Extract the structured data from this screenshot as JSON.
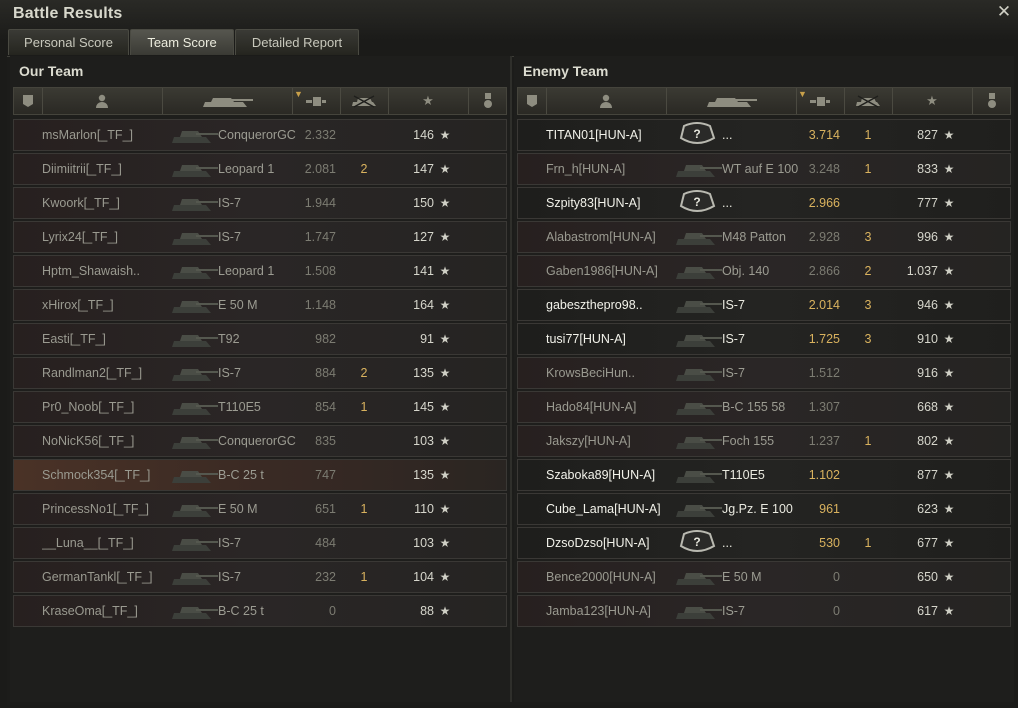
{
  "window": {
    "title": "Battle Results"
  },
  "tabs": [
    {
      "label": "Personal Score",
      "active": false
    },
    {
      "label": "Team Score",
      "active": true
    },
    {
      "label": "Detailed Report",
      "active": false
    }
  ],
  "our_team": {
    "title": "Our Team",
    "rows": [
      {
        "player": "msMarlon[_TF_]",
        "tank": "ConquerorGC",
        "damage": "2.332",
        "kills": "",
        "xp": "146",
        "alive": false,
        "highlight": false
      },
      {
        "player": "Diimiitrii[_TF_]",
        "tank": "Leopard 1",
        "damage": "2.081",
        "kills": "2",
        "xp": "147",
        "alive": false,
        "highlight": false
      },
      {
        "player": "Kwoork[_TF_]",
        "tank": "IS-7",
        "damage": "1.944",
        "kills": "",
        "xp": "150",
        "alive": false,
        "highlight": false
      },
      {
        "player": "Lyrix24[_TF_]",
        "tank": "IS-7",
        "damage": "1.747",
        "kills": "",
        "xp": "127",
        "alive": false,
        "highlight": false
      },
      {
        "player": "Hptm_Shawaish..",
        "tank": "Leopard 1",
        "damage": "1.508",
        "kills": "",
        "xp": "141",
        "alive": false,
        "highlight": false
      },
      {
        "player": "xHirox[_TF_]",
        "tank": "E 50 M",
        "damage": "1.148",
        "kills": "",
        "xp": "164",
        "alive": false,
        "highlight": false
      },
      {
        "player": "Easti[_TF_]",
        "tank": "T92",
        "damage": "982",
        "kills": "",
        "xp": "91",
        "alive": false,
        "highlight": false
      },
      {
        "player": "Randlman2[_TF_]",
        "tank": "IS-7",
        "damage": "884",
        "kills": "2",
        "xp": "135",
        "alive": false,
        "highlight": false
      },
      {
        "player": "Pr0_Noob[_TF_]",
        "tank": "T110E5",
        "damage": "854",
        "kills": "1",
        "xp": "145",
        "alive": false,
        "highlight": false
      },
      {
        "player": "NoNicK56[_TF_]",
        "tank": "ConquerorGC",
        "damage": "835",
        "kills": "",
        "xp": "103",
        "alive": false,
        "highlight": false
      },
      {
        "player": "Schmock354[_TF_]",
        "tank": "B-C 25 t",
        "damage": "747",
        "kills": "",
        "xp": "135",
        "alive": false,
        "highlight": true
      },
      {
        "player": "PrincessNo1[_TF_]",
        "tank": "E 50 M",
        "damage": "651",
        "kills": "1",
        "xp": "110",
        "alive": false,
        "highlight": false
      },
      {
        "player": "__Luna__[_TF_]",
        "tank": "IS-7",
        "damage": "484",
        "kills": "",
        "xp": "103",
        "alive": false,
        "highlight": false
      },
      {
        "player": "GermanTankl[_TF_]",
        "tank": "IS-7",
        "damage": "232",
        "kills": "1",
        "xp": "104",
        "alive": false,
        "highlight": false
      },
      {
        "player": "KraseOma[_TF_]",
        "tank": "B-C 25 t",
        "damage": "0",
        "kills": "",
        "xp": "88",
        "alive": false,
        "highlight": false
      }
    ]
  },
  "enemy_team": {
    "title": "Enemy Team",
    "rows": [
      {
        "player": "TITAN01[HUN-A]",
        "tank": "...",
        "unknown": true,
        "damage": "3.714",
        "kills": "1",
        "xp": "827",
        "alive": true
      },
      {
        "player": "Frn_h[HUN-A]",
        "tank": "WT auf E 100",
        "unknown": false,
        "damage": "3.248",
        "kills": "1",
        "xp": "833",
        "alive": false
      },
      {
        "player": "Szpity83[HUN-A]",
        "tank": "...",
        "unknown": true,
        "damage": "2.966",
        "kills": "",
        "xp": "777",
        "alive": true
      },
      {
        "player": "Alabastrom[HUN-A]",
        "tank": "M48 Patton",
        "unknown": false,
        "damage": "2.928",
        "kills": "3",
        "xp": "996",
        "alive": false
      },
      {
        "player": "Gaben1986[HUN-A]",
        "tank": "Obj. 140",
        "unknown": false,
        "damage": "2.866",
        "kills": "2",
        "xp": "1.037",
        "alive": false
      },
      {
        "player": "gabeszthepro98..",
        "tank": "IS-7",
        "unknown": false,
        "damage": "2.014",
        "kills": "3",
        "xp": "946",
        "alive": true
      },
      {
        "player": "tusi77[HUN-A]",
        "tank": "IS-7",
        "unknown": false,
        "damage": "1.725",
        "kills": "3",
        "xp": "910",
        "alive": true
      },
      {
        "player": "KrowsBeciHun..",
        "tank": "IS-7",
        "unknown": false,
        "damage": "1.512",
        "kills": "",
        "xp": "916",
        "alive": false
      },
      {
        "player": "Hado84[HUN-A]",
        "tank": "B-C 155 58",
        "unknown": false,
        "damage": "1.307",
        "kills": "",
        "xp": "668",
        "alive": false
      },
      {
        "player": "Jakszy[HUN-A]",
        "tank": "Foch 155",
        "unknown": false,
        "damage": "1.237",
        "kills": "1",
        "xp": "802",
        "alive": false
      },
      {
        "player": "Szaboka89[HUN-A]",
        "tank": "T110E5",
        "unknown": false,
        "damage": "1.102",
        "kills": "",
        "xp": "877",
        "alive": true
      },
      {
        "player": "Cube_Lama[HUN-A]",
        "tank": "Jg.Pz. E 100",
        "unknown": false,
        "damage": "961",
        "kills": "",
        "xp": "623",
        "alive": true
      },
      {
        "player": "DzsoDzso[HUN-A]",
        "tank": "...",
        "unknown": true,
        "damage": "530",
        "kills": "1",
        "xp": "677",
        "alive": true
      },
      {
        "player": "Bence2000[HUN-A]",
        "tank": "E 50 M",
        "unknown": false,
        "damage": "0",
        "kills": "",
        "xp": "650",
        "alive": false
      },
      {
        "player": "Jamba123[HUN-A]",
        "tank": "IS-7",
        "unknown": false,
        "damage": "0",
        "kills": "",
        "xp": "617",
        "alive": false
      }
    ]
  },
  "columns": [
    {
      "icon": "squad-icon"
    },
    {
      "icon": "player-icon"
    },
    {
      "icon": "tank-icon"
    },
    {
      "icon": "damage-icon",
      "sorted": true
    },
    {
      "icon": "kills-icon"
    },
    {
      "icon": "xp-star-icon"
    },
    {
      "icon": "medal-icon"
    }
  ],
  "colors": {
    "accent": "#d9b25e",
    "highlight": "#4a3226"
  }
}
